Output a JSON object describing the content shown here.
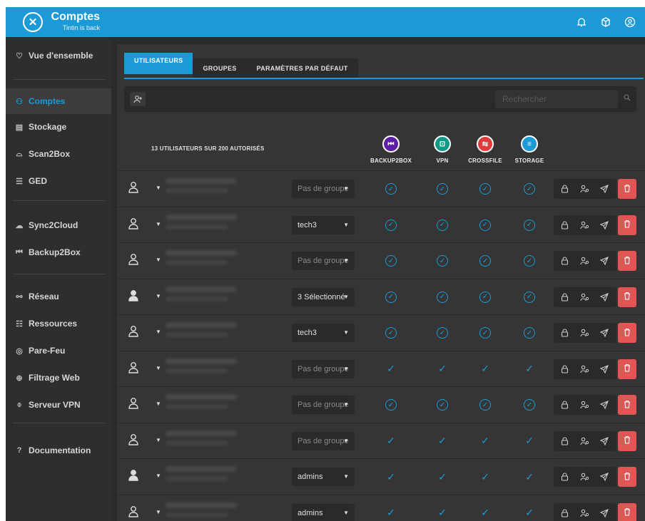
{
  "header": {
    "title": "Comptes",
    "subtitle": "Tintin is back",
    "logo_icon": "tools-icon",
    "icons": [
      "bell-icon",
      "box-icon",
      "user-circle-icon"
    ]
  },
  "sidebar": {
    "items": [
      {
        "label": "Vue d'ensemble",
        "icon": "heart-icon",
        "symbol": "♡"
      },
      {
        "label": "Comptes",
        "icon": "users-icon",
        "symbol": "⚇",
        "active": true
      },
      {
        "label": "Stockage",
        "icon": "storage-icon",
        "symbol": "▤"
      },
      {
        "label": "Scan2Box",
        "icon": "scanner-icon",
        "symbol": "⌓"
      },
      {
        "label": "GED",
        "icon": "list-icon",
        "symbol": "☰"
      },
      {
        "label": "Sync2Cloud",
        "icon": "cloud-icon",
        "symbol": "☁"
      },
      {
        "label": "Backup2Box",
        "icon": "rewind-icon",
        "symbol": "⏮"
      },
      {
        "label": "Réseau",
        "icon": "network-icon",
        "symbol": "⚯"
      },
      {
        "label": "Ressources",
        "icon": "resources-icon",
        "symbol": "☷"
      },
      {
        "label": "Pare-Feu",
        "icon": "firewall-icon",
        "symbol": "◎"
      },
      {
        "label": "Filtrage Web",
        "icon": "globe-icon",
        "symbol": "⊕"
      },
      {
        "label": "Serveur VPN",
        "icon": "vpn-icon",
        "symbol": "⌽"
      },
      {
        "label": "Documentation",
        "icon": "help-icon",
        "symbol": "?"
      }
    ]
  },
  "tabs": [
    {
      "label": "UTILISATEURS",
      "active": true
    },
    {
      "label": "GROUPES"
    },
    {
      "label": "PARAMÈTRES PAR DÉFAUT"
    }
  ],
  "toolbar": {
    "search_placeholder": "Rechercher"
  },
  "list": {
    "count_label": "13 UTILISATEURS SUR 200 AUTORISÉS",
    "services": [
      {
        "label": "BACKUP2BOX",
        "icon": "backup-icon",
        "color": "#5b1fa8",
        "glyph": "⏮"
      },
      {
        "label": "VPN",
        "icon": "vpn-lock-icon",
        "color": "#129a86",
        "glyph": "⊡"
      },
      {
        "label": "CROSSFILE",
        "icon": "crossfile-icon",
        "color": "#e03c3c",
        "glyph": "⇆"
      },
      {
        "label": "STORAGE",
        "icon": "storage-disk-icon",
        "color": "#1c9ad6",
        "glyph": "≡"
      }
    ],
    "rows": [
      {
        "user_icon": "user-outline-icon",
        "group": "Pas de groupe",
        "group_empty": true,
        "check_style": "circle"
      },
      {
        "user_icon": "user-outline-icon",
        "group": "tech3",
        "group_empty": false,
        "check_style": "circle"
      },
      {
        "user_icon": "user-outline-icon",
        "group": "Pas de groupe",
        "group_empty": true,
        "check_style": "circle"
      },
      {
        "user_icon": "admin-user-icon",
        "group": "3 Sélectionné",
        "group_empty": false,
        "check_style": "circle"
      },
      {
        "user_icon": "user-outline-icon",
        "group": "tech3",
        "group_empty": false,
        "check_style": "circle"
      },
      {
        "user_icon": "user-outline-icon",
        "group": "Pas de groupe",
        "group_empty": true,
        "check_style": "plain"
      },
      {
        "user_icon": "user-outline-icon",
        "group": "Pas de groupe",
        "group_empty": true,
        "check_style": "circle"
      },
      {
        "user_icon": "user-outline-icon",
        "group": "Pas de groupe",
        "group_empty": true,
        "check_style": "plain"
      },
      {
        "user_icon": "admin-user-icon",
        "group": "admins",
        "group_empty": false,
        "check_style": "plain"
      },
      {
        "user_icon": "badge-user-icon",
        "group": "admins",
        "group_empty": false,
        "check_style": "plain"
      }
    ],
    "row_actions": [
      "lock-icon",
      "user-key-icon",
      "send-icon",
      "trash-icon"
    ]
  },
  "colors": {
    "accent": "#1c9ad6",
    "danger": "#e25555"
  }
}
